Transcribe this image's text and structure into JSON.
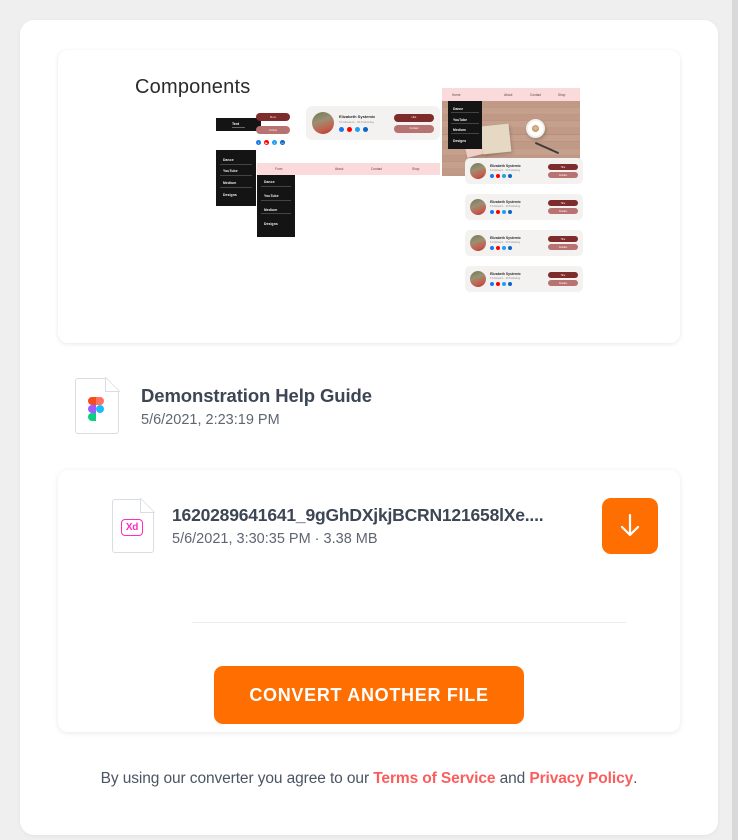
{
  "page": {
    "background_color": "#efeff0",
    "card_background": "#ffffff",
    "accent_color": "#ff6e00",
    "link_color": "#fb5d5d",
    "title_color": "#3d4654"
  },
  "preview": {
    "heading": "Components",
    "text_label": "Text",
    "nav_items": [
      "Dance",
      "YouTube",
      "Medium",
      "Designs"
    ],
    "site_nav": [
      "Home",
      "About",
      "Contact",
      "Shop"
    ],
    "pink_bar_items": [
      "Form",
      "About",
      "Contact",
      "Shop"
    ],
    "pills": [
      "More",
      "Follow"
    ],
    "profile": {
      "name": "Elizabeth Systemic",
      "meta": "5 Followers  ·  20 Following",
      "buttons": [
        "Hire",
        "Contact"
      ]
    },
    "social_icons": [
      "facebook-icon",
      "youtube-icon",
      "twitter-icon",
      "dribbble-icon"
    ],
    "card_count": 4
  },
  "source_file": {
    "icon": "figma-file-icon",
    "title": "Demonstration Help Guide",
    "subtitle": "5/6/2021, 2:23:19 PM"
  },
  "converted_file": {
    "icon": "xd-file-icon",
    "icon_label": "Xd",
    "name": "1620289641641_9gGhDXjkjBCRN121658lXe....",
    "date": "5/6/2021, 3:30:35 PM",
    "separator": " · ",
    "size": "3.38 MB",
    "download_icon": "download-arrow-icon"
  },
  "cta": {
    "label": "CONVERT ANOTHER FILE"
  },
  "footer": {
    "prefix": "By using our converter you agree to our ",
    "terms_link": "Terms of Service",
    "middle": " and ",
    "privacy_link": "Privacy Policy",
    "suffix": "."
  }
}
